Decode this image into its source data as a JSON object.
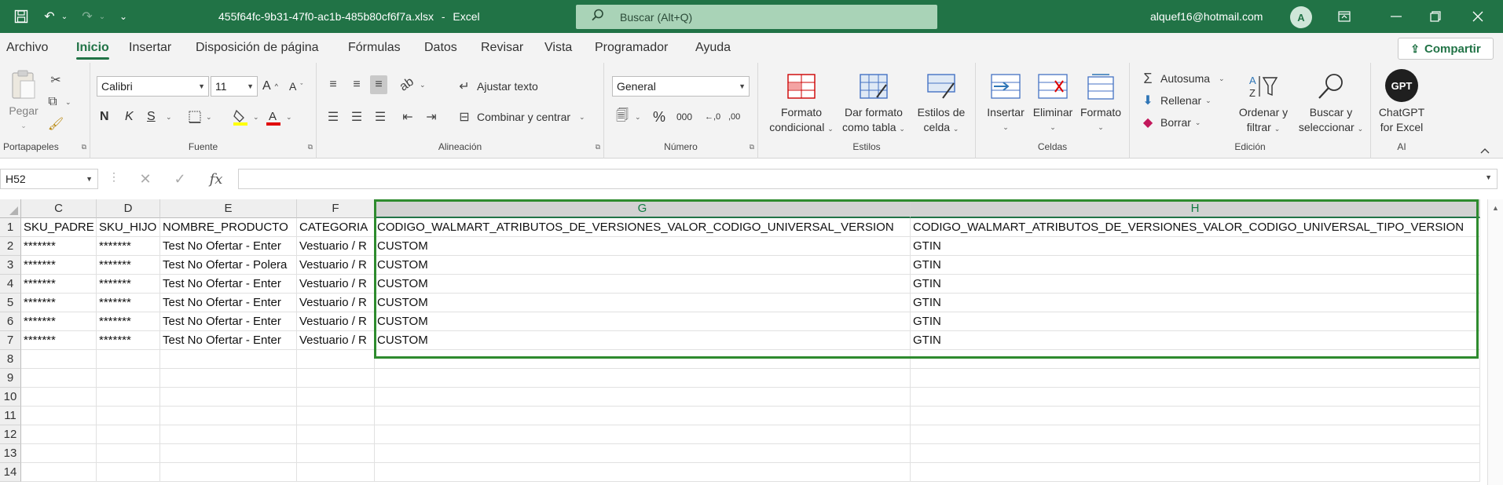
{
  "titlebar": {
    "filename": "455f64fc-9b31-47f0-ac1b-485b80cf6f7a.xlsx",
    "app": "Excel",
    "separator": "-",
    "search_placeholder": "Buscar (Alt+Q)",
    "user_email": "alquef16@hotmail.com",
    "avatar_initial": "A"
  },
  "tabs": [
    "Archivo",
    "Inicio",
    "Insertar",
    "Disposición de página",
    "Fórmulas",
    "Datos",
    "Revisar",
    "Vista",
    "Programador",
    "Ayuda"
  ],
  "active_tab": "Inicio",
  "share_label": "Compartir",
  "ribbon": {
    "clipboard": {
      "paste": "Pegar",
      "label": "Portapapeles"
    },
    "font": {
      "name": "Calibri",
      "size": "11",
      "bold": "N",
      "italic": "K",
      "underline": "S",
      "label": "Fuente"
    },
    "alignment": {
      "wrap_text": "Ajustar texto",
      "merge_center": "Combinar y centrar",
      "label": "Alineación"
    },
    "number": {
      "format": "General",
      "thousands": "000",
      "label": "Número"
    },
    "styles": {
      "conditional_1": "Formato",
      "conditional_2": "condicional",
      "table_1": "Dar formato",
      "table_2": "como tabla",
      "cell_styles_1": "Estilos de",
      "cell_styles_2": "celda",
      "label": "Estilos"
    },
    "cells": {
      "insert": "Insertar",
      "delete": "Eliminar",
      "format": "Formato",
      "label": "Celdas"
    },
    "editing": {
      "autosum": "Autosuma",
      "fill": "Rellenar",
      "clear": "Borrar",
      "sort_1": "Ordenar y",
      "sort_2": "filtrar",
      "find_1": "Buscar y",
      "find_2": "seleccionar",
      "label": "Edición"
    },
    "ai": {
      "gpt_badge": "GPT",
      "chatgpt_1": "ChatGPT",
      "chatgpt_2": "for Excel",
      "label": "AI"
    }
  },
  "formula_bar": {
    "name_box": "H52",
    "formula": "",
    "fx": "fx"
  },
  "columns": [
    "C",
    "D",
    "E",
    "F",
    "G",
    "H"
  ],
  "selected_columns": [
    "G",
    "H"
  ],
  "row_numbers": [
    "1",
    "2",
    "3",
    "4",
    "5",
    "6",
    "7",
    "8",
    "9",
    "10",
    "11",
    "12",
    "13",
    "14"
  ],
  "rows": [
    [
      "SKU_PADRE",
      "SKU_HIJO",
      "NOMBRE_PRODUCTO",
      "CATEGORIA",
      "CODIGO_WALMART_ATRIBUTOS_DE_VERSIONES_VALOR_CODIGO_UNIVERSAL_VERSION",
      "CODIGO_WALMART_ATRIBUTOS_DE_VERSIONES_VALOR_CODIGO_UNIVERSAL_TIPO_VERSION"
    ],
    [
      "*******",
      "*******",
      "Test No Ofertar - Enter",
      "Vestuario / R",
      "CUSTOM",
      "GTIN"
    ],
    [
      "*******",
      "*******",
      "Test No Ofertar - Polera",
      "Vestuario / R",
      "CUSTOM",
      "GTIN"
    ],
    [
      "*******",
      "*******",
      "Test No Ofertar - Enter",
      "Vestuario / R",
      "CUSTOM",
      "GTIN"
    ],
    [
      "*******",
      "*******",
      "Test No Ofertar - Enter",
      "Vestuario / R",
      "CUSTOM",
      "GTIN"
    ],
    [
      "*******",
      "*******",
      "Test No Ofertar - Enter",
      "Vestuario / R",
      "CUSTOM",
      "GTIN"
    ],
    [
      "*******",
      "*******",
      "Test No Ofertar - Enter",
      "Vestuario / R",
      "CUSTOM",
      "GTIN"
    ]
  ],
  "colors": {
    "excel_green": "#217346",
    "selection_border": "#2e8b2e"
  }
}
